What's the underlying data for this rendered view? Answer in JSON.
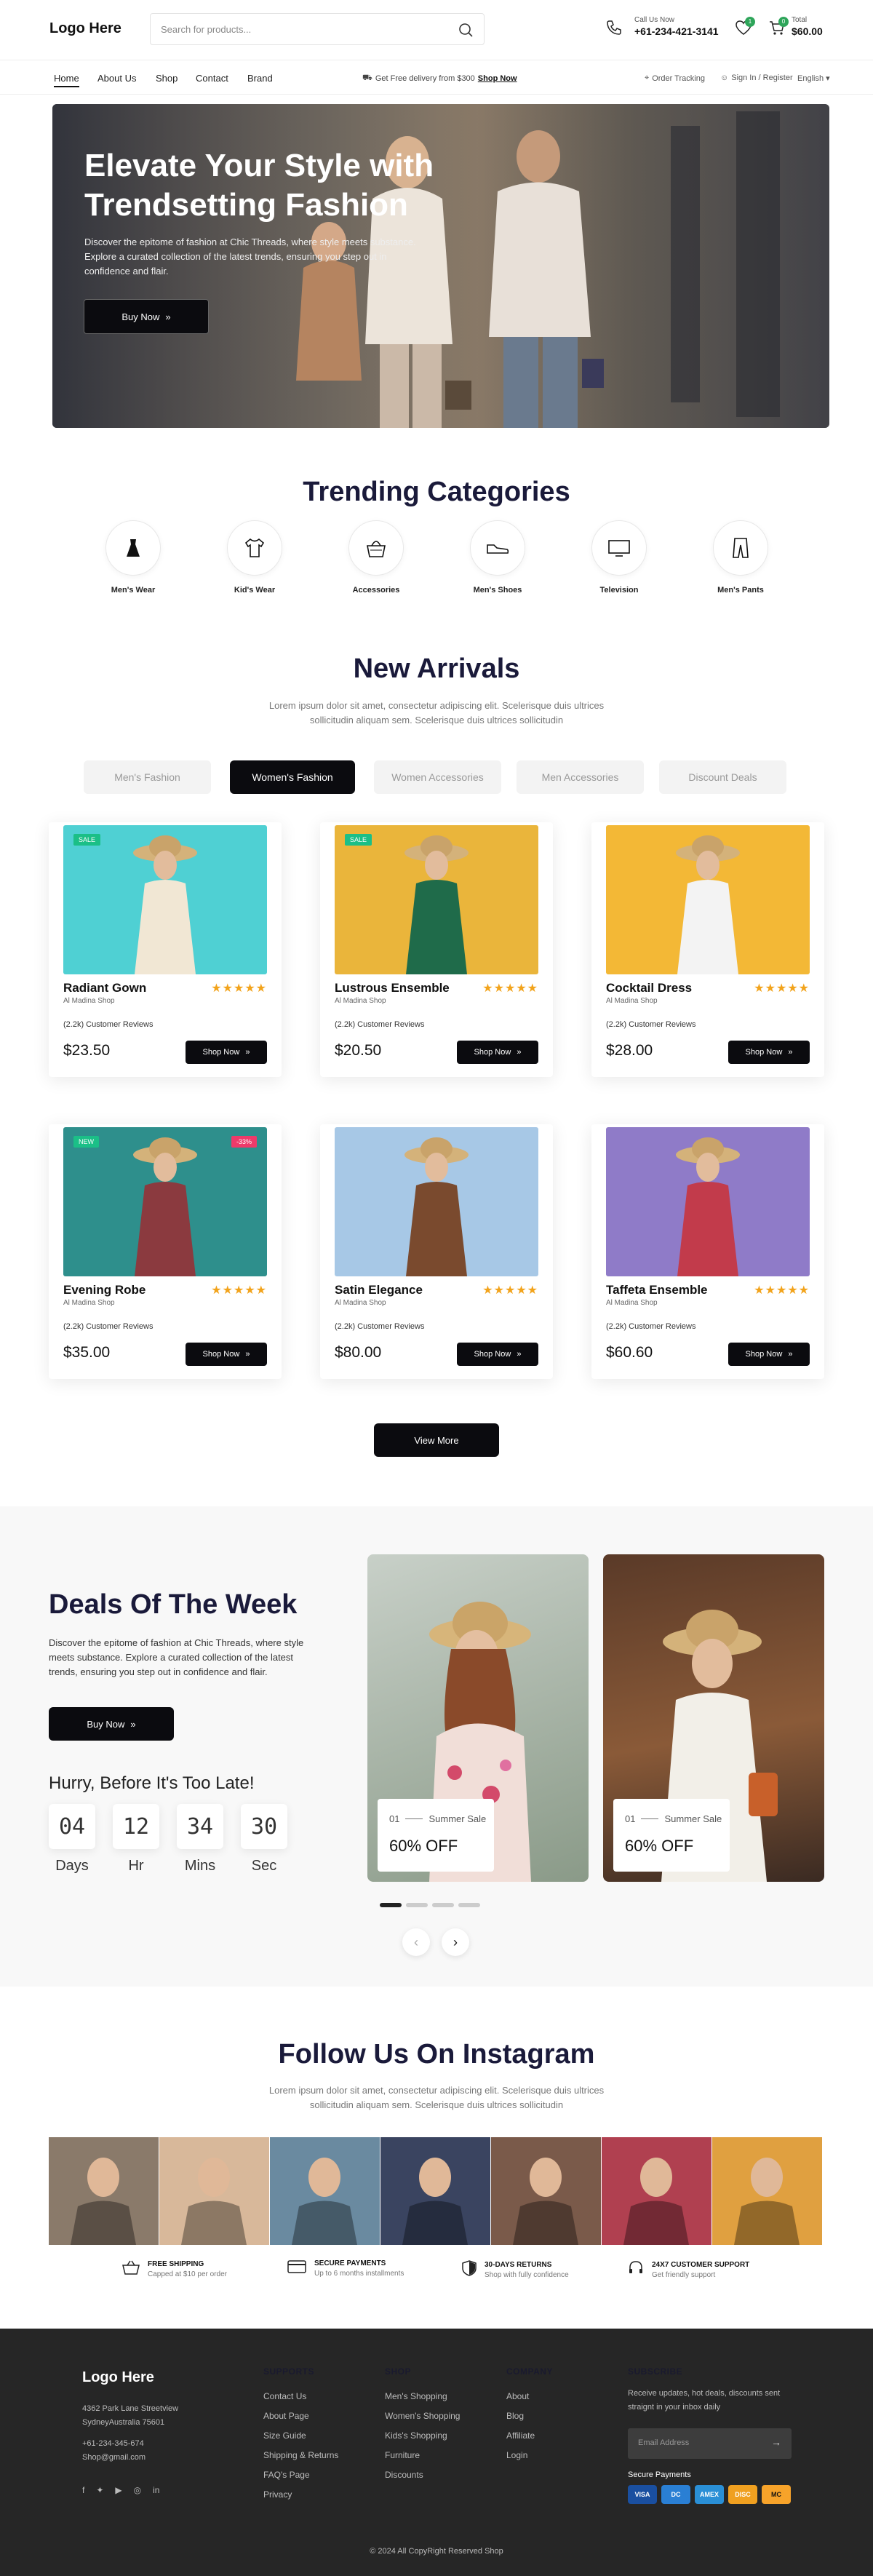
{
  "header": {
    "logo": "Logo Here",
    "search_placeholder": "Search for products...",
    "call_label": "Call Us Now",
    "phone": "+61-234-421-3141",
    "wishlist_count": "1",
    "cart_count": "0",
    "total_label": "Total",
    "total_value": "$60.00"
  },
  "nav": {
    "links": [
      "Home",
      "About Us",
      "Shop",
      "Contact",
      "Brand"
    ],
    "promo": "Get Free delivery from $300",
    "promo_link": "Shop Now",
    "order_tracking": "Order Tracking",
    "sign_in": "Sign In / Register",
    "language": "English"
  },
  "hero": {
    "title": "Elevate Your Style with Trendsetting Fashion",
    "text": "Discover the epitome of fashion at Chic Threads, where style meets substance. Explore a curated collection of the latest trends, ensuring you step out in confidence and flair.",
    "button": "Buy Now"
  },
  "categories": {
    "title": "Trending Categories",
    "items": [
      {
        "label": "Men's Wear",
        "icon": "dress-icon"
      },
      {
        "label": "Kid's Wear",
        "icon": "tshirt-icon"
      },
      {
        "label": "Accessories",
        "icon": "basket-icon"
      },
      {
        "label": "Men's Shoes",
        "icon": "shoe-icon"
      },
      {
        "label": "Television",
        "icon": "tv-icon"
      },
      {
        "label": "Men's Pants",
        "icon": "pants-icon"
      }
    ]
  },
  "arrivals": {
    "title": "New Arrivals",
    "subtitle": "Lorem ipsum dolor sit amet, consectetur adipiscing elit. Scelerisque duis ultrices sollicitudin aliquam sem. Scelerisque duis ultrices sollicitudin",
    "tabs": [
      "Men's Fashion",
      "Women's Fashion",
      "Women Accessories",
      "Men Accessories",
      "Discount Deals"
    ],
    "active_tab": "Women's Fashion",
    "products": [
      {
        "name": "Radiant Gown",
        "shop": "Al Madina Shop",
        "reviews": "(2.2k) Customer Reviews",
        "price": "$23.50",
        "badge": "SALE",
        "rating": 5,
        "bg": "#4fd0d3",
        "dress": "#f1e7d4"
      },
      {
        "name": "Lustrous Ensemble",
        "shop": "Al Madina Shop",
        "reviews": "(2.2k) Customer Reviews",
        "price": "$20.50",
        "badge": "SALE",
        "rating": 5,
        "bg": "#eab53b",
        "dress": "#1f6b4a"
      },
      {
        "name": "Cocktail Dress",
        "shop": "Al Madina Shop",
        "reviews": "(2.2k) Customer Reviews",
        "price": "$28.00",
        "badge": "",
        "rating": 5,
        "bg": "#f3b836",
        "dress": "#f3f3f3"
      },
      {
        "name": "Evening Robe",
        "shop": "Al Madina Shop",
        "reviews": "(2.2k) Customer Reviews",
        "price": "$35.00",
        "badge": "NEW",
        "badge2": "-33%",
        "rating": 5,
        "bg": "#2e8f8c",
        "dress": "#8b3a3f"
      },
      {
        "name": "Satin Elegance",
        "shop": "Al Madina Shop",
        "reviews": "(2.2k) Customer Reviews",
        "price": "$80.00",
        "badge": "",
        "rating": 5,
        "bg": "#a7c8e6",
        "dress": "#7a4a2e"
      },
      {
        "name": "Taffeta Ensemble",
        "shop": "Al Madina Shop",
        "reviews": "(2.2k) Customer Reviews",
        "price": "$60.60",
        "badge": "",
        "rating": 5,
        "bg": "#8f7bc8",
        "dress": "#c23b4b"
      }
    ],
    "buy_label": "Shop Now",
    "view_more": "View More"
  },
  "deals": {
    "title": "Deals Of The Week",
    "text": "Discover the epitome of fashion at Chic Threads, where style meets substance. Explore a curated collection of the latest trends, ensuring you step out in confidence and flair.",
    "button": "Buy Now",
    "hurry": "Hurry, Before It's Too Late!",
    "countdown": [
      {
        "value": "04",
        "label": "Days"
      },
      {
        "value": "12",
        "label": "Hr"
      },
      {
        "value": "34",
        "label": "Mins"
      },
      {
        "value": "30",
        "label": "Sec"
      }
    ],
    "cards": [
      {
        "num": "01",
        "tag": "Summer Sale",
        "offer": "60% OFF"
      },
      {
        "num": "01",
        "tag": "Summer Sale",
        "offer": "60% OFF"
      }
    ]
  },
  "instagram": {
    "title": "Follow Us On Instagram",
    "subtitle": "Lorem ipsum dolor sit amet, consectetur adipiscing elit. Scelerisque duis ultrices sollicitudin aliquam sem. Scelerisque duis ultrices sollicitudin",
    "tiles": [
      "#8a7a6a",
      "#d8b89a",
      "#6a8aa0",
      "#3a4460",
      "#7a5a4a",
      "#b04050",
      "#e0a040"
    ]
  },
  "features": [
    {
      "title": "FREE SHIPPING",
      "sub": "Capped at $10 per order"
    },
    {
      "title": "SECURE PAYMENTS",
      "sub": "Up to 6 months installments"
    },
    {
      "title": "30-DAYS RETURNS",
      "sub": "Shop with fully confidence"
    },
    {
      "title": "24X7 CUSTOMER SUPPORT",
      "sub": "Get friendly support"
    }
  ],
  "footer": {
    "logo": "Logo Here",
    "address1": "4362 Park Lane Streetview",
    "address2": "SydneyAustralia 75601",
    "phone": "+61-234-345-674",
    "email": "Shop@gmail.com",
    "supports": {
      "title": "SUPPORTS",
      "items": [
        "Contact Us",
        "About Page",
        "Size Guide",
        "Shipping & Returns",
        "FAQ's Page",
        "Privacy"
      ]
    },
    "shop": {
      "title": "SHOP",
      "items": [
        "Men's Shopping",
        "Women's Shopping",
        "Kids's Shopping",
        "Furniture",
        "Discounts"
      ]
    },
    "company": {
      "title": "COMPANY",
      "items": [
        "About",
        "Blog",
        "Affiliate",
        "Login"
      ]
    },
    "subscribe": {
      "title": "SUBSCRIBE",
      "text": "Receive updates, hot deals, discounts sent straignt in your inbox daily",
      "placeholder": "Email Address",
      "secure": "Secure Payments"
    },
    "payments": [
      "VISA",
      "DC",
      "AMEX",
      "DISC",
      "MC"
    ],
    "copyright": "© 2024 All CopyRight Reserved Shop"
  }
}
